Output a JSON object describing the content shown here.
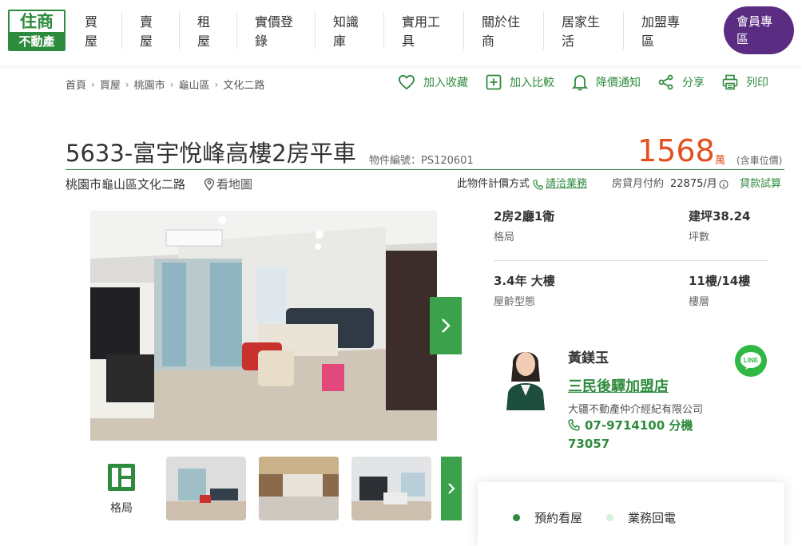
{
  "brand": {
    "logo_top": "住商",
    "logo_bottom": "不動產",
    "green": "#2e8b3e",
    "purple": "#5b2d82",
    "price_color": "#e2501f"
  },
  "nav": {
    "items": [
      {
        "label": "買\n屋"
      },
      {
        "label": "賣\n屋"
      },
      {
        "label": "租\n屋"
      },
      {
        "label": "實價登\n錄"
      },
      {
        "label": "知識\n庫"
      },
      {
        "label": "實用工\n具"
      },
      {
        "label": "關於住\n商"
      },
      {
        "label": "居家生\n活"
      },
      {
        "label": "加盟專\n區"
      }
    ],
    "member": "會員專\n區"
  },
  "breadcrumb": [
    "首頁",
    "買屋",
    "桃園市",
    "龜山區",
    "文化二路"
  ],
  "actions": {
    "favorite": "加入收藏",
    "compare": "加入比較",
    "price_alert": "降價通知",
    "share": "分享",
    "print": "列印"
  },
  "listing": {
    "title": "5633-富宇悅峰高樓2房平車",
    "object_no": "物件編號：PS120601",
    "price": "1568",
    "price_unit": "萬",
    "price_note": "(含車位價)",
    "address": "桃園市龜山區文化二路",
    "map_link": "看地圖",
    "pricing_label": "此物件計價方式",
    "pricing_link": "請洽業務",
    "monthly_label": "房貸月付約",
    "monthly_value": "22875/月",
    "loan_calc": "貸款試算"
  },
  "specs": [
    {
      "value": "2房2廳1衛",
      "label": "格局"
    },
    {
      "value": "建坪38.24",
      "label": "坪數"
    },
    {
      "value": "3.4年 大樓",
      "label": "屋齡型態"
    },
    {
      "value": "11樓/14樓",
      "label": "樓層"
    }
  ],
  "gallery": {
    "floorplan_label": "格局"
  },
  "agent": {
    "name": "黃鎂玉",
    "store": "三民後驛加盟店",
    "company": "大疆不動產仲介經紀有限公司",
    "phone": "07-9714100 分機\n73057",
    "line_label": "LINE"
  },
  "card": {
    "tab1": "預約看屋",
    "tab2": "業務回電"
  }
}
